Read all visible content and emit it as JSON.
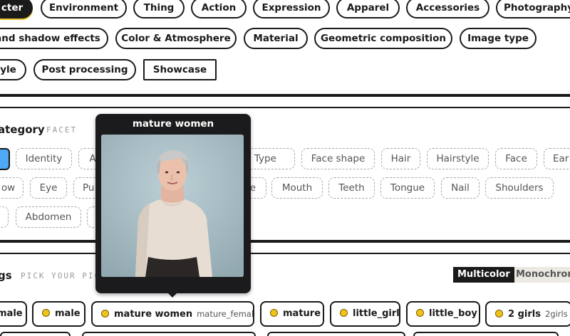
{
  "categories": [
    {
      "label": "cter",
      "active": true
    },
    {
      "label": "Environment"
    },
    {
      "label": "Thing"
    },
    {
      "label": "Action"
    },
    {
      "label": "Expression"
    },
    {
      "label": "Apparel"
    },
    {
      "label": "Accessories"
    },
    {
      "label": "Photography"
    },
    {
      "label": "and shadow effects"
    },
    {
      "label": "Color & Atmosphere"
    },
    {
      "label": "Material"
    },
    {
      "label": "Geometric composition"
    },
    {
      "label": "Image type"
    },
    {
      "label": "yle"
    },
    {
      "label": "Post processing"
    },
    {
      "label": "Showcase"
    }
  ],
  "category_section": {
    "title": "ategory",
    "subtitle": "FACET"
  },
  "facets": [
    "Identity",
    "A",
    "dy Type",
    "Face shape",
    "Hair",
    "Hairstyle",
    "Face",
    "Ear",
    "ow",
    "Eye",
    "Pu",
    "e",
    "Mouth",
    "Teeth",
    "Tongue",
    "Nail",
    "Shoulders",
    "Abdomen"
  ],
  "tags_section": {
    "title": "gs",
    "subtitle": "PICK YOUR PIC"
  },
  "color_toggle": {
    "multicolor": "Multicolor",
    "monochrome": "Monochrom"
  },
  "tags": [
    {
      "label": "male"
    },
    {
      "label": "male"
    },
    {
      "label": "mature women",
      "alias": "mature_female"
    },
    {
      "label": "mature"
    },
    {
      "label": "little_girl"
    },
    {
      "label": "little_boy"
    },
    {
      "label": "2 girls",
      "alias": "2girls"
    }
  ],
  "popover": {
    "title": "mature women",
    "image": "portrait of an elderly woman with short gray hair wearing a cream sweater"
  },
  "colors": {
    "ink": "#1a1a1a",
    "accent_yellow": "#f2c21b",
    "popover_bg": "#1b1b1d"
  }
}
